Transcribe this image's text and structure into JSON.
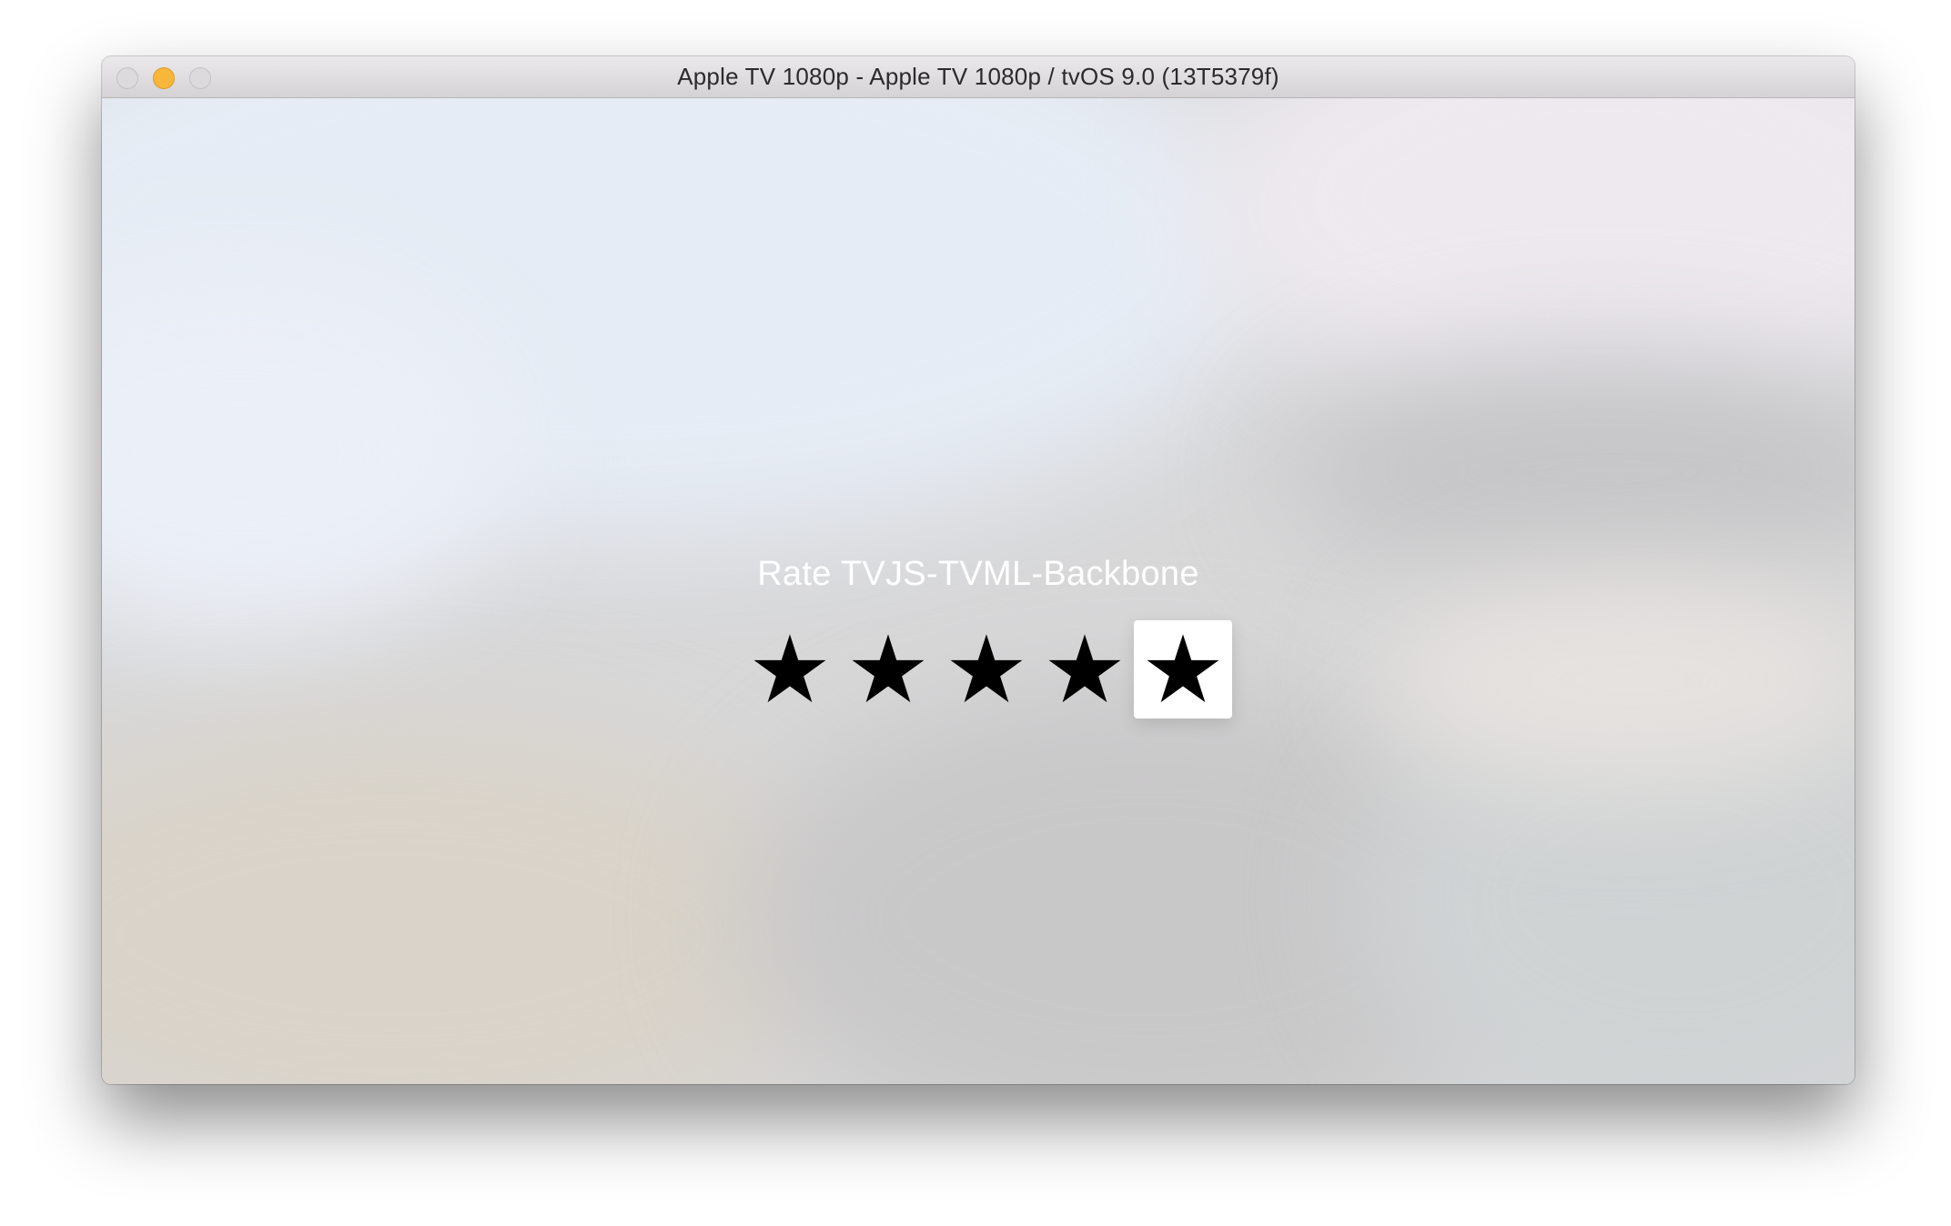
{
  "window": {
    "title": "Apple TV 1080p - Apple TV 1080p / tvOS 9.0 (13T5379f)",
    "controls": [
      "close",
      "minimize",
      "zoom"
    ]
  },
  "rating": {
    "prompt": "Rate TVJS-TVML-Backbone",
    "max_stars": 5,
    "focused_star": 5,
    "star_icon": "star-icon",
    "star_color": "#000000",
    "focus_background": "#ffffff"
  }
}
